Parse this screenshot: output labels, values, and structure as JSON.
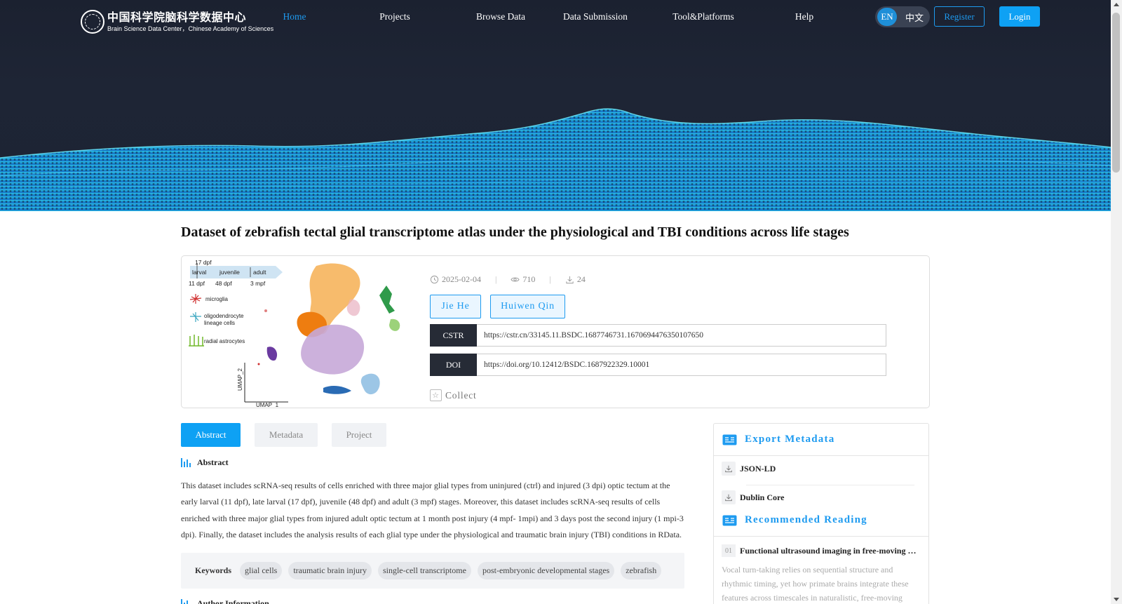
{
  "header": {
    "logo_cn": "中国科学院脑科学数据中心",
    "logo_en": "Brain Science Data Center，Chinese Academy of Sciences",
    "nav": [
      {
        "label": "Home",
        "active": true
      },
      {
        "label": "Projects",
        "active": false
      },
      {
        "label": "Browse Data",
        "active": false
      },
      {
        "label": "Data Submission",
        "active": false
      },
      {
        "label": "Tool&Platforms",
        "active": false
      },
      {
        "label": "Help",
        "active": false
      }
    ],
    "lang_en": "EN",
    "lang_cn": "中文",
    "register": "Register",
    "login": "Login"
  },
  "dataset": {
    "title": "Dataset of zebrafish tectal glial transcriptome atlas under the physiological and TBI conditions across life stages",
    "date": "2025-02-04",
    "views": "710",
    "downloads": "24",
    "authors": [
      "Jie He",
      "Huiwen Qin"
    ],
    "cstr_label": "CSTR",
    "cstr_value": "https://cstr.cn/33145.11.BSDC.1687746731.1670694476350107650",
    "doi_label": "DOI",
    "doi_value": "https://doi.org/10.12412/BSDC.1687922329.10001",
    "collect": "Collect"
  },
  "thumbnail": {
    "stage_17": "17 dpf",
    "stage_larval": "larval",
    "stage_juvenile": "juvenile",
    "stage_adult": "adult",
    "stage_11": "11 dpf",
    "stage_48": "48 dpf",
    "stage_3m": "3 mpf",
    "legend_microglia": "microglia",
    "legend_oligo_1": "oligodendrocyte",
    "legend_oligo_2": "lineage cells",
    "legend_radial": "radial astrocytes",
    "axis_y": "UMAP_2",
    "axis_x": "UMAP_1"
  },
  "tabs": [
    {
      "label": "Abstract",
      "active": true
    },
    {
      "label": "Metadata",
      "active": false
    },
    {
      "label": "Project",
      "active": false
    }
  ],
  "abstract": {
    "heading": "Abstract",
    "text": "This dataset includes scRNA-seq results of cells enriched with three major glial types from uninjured (ctrl) and injured (3 dpi) optic tectum at the early larval (11 dpf), late larval (17 dpf), juvenile (48 dpf) and adult (3 mpf) stages. Moreover, this dataset includes scRNA-seq results of cells enriched with three major glial types from injured adult optic tectum at 1 month post injury (4 mpf- 1mpi) and 3 days post the second injury (1 mpi-3 dpi). Finally, the dataset includes the analysis results of each glial type under the physiological and traumatic brain injury (TBI) conditions in RData.",
    "keywords_label": "Keywords",
    "keywords": [
      "glial cells",
      "traumatic brain injury",
      "single-cell transcriptome",
      "post-embryonic developmental stages",
      "zebrafish"
    ],
    "author_info_heading": "Author Information"
  },
  "side": {
    "export_heading": "Export Metadata",
    "export_items": [
      "JSON-LD",
      "Dublin Core"
    ],
    "recommended_heading": "Recommended Reading",
    "rec_num": "01",
    "rec_title": "Functional ultrasound imaging in free-moving marmosets",
    "rec_desc": "Vocal turn-taking relies on sequential structure and rhythmic timing, yet how primate brains integrate these features across timescales in naturalistic, free-moving contexts is unclear."
  },
  "colors": {
    "accent": "#1e9bf0",
    "login_bg": "#0ea1f4",
    "banner_bg": "#1c2434",
    "id_label_bg": "#262b36"
  }
}
